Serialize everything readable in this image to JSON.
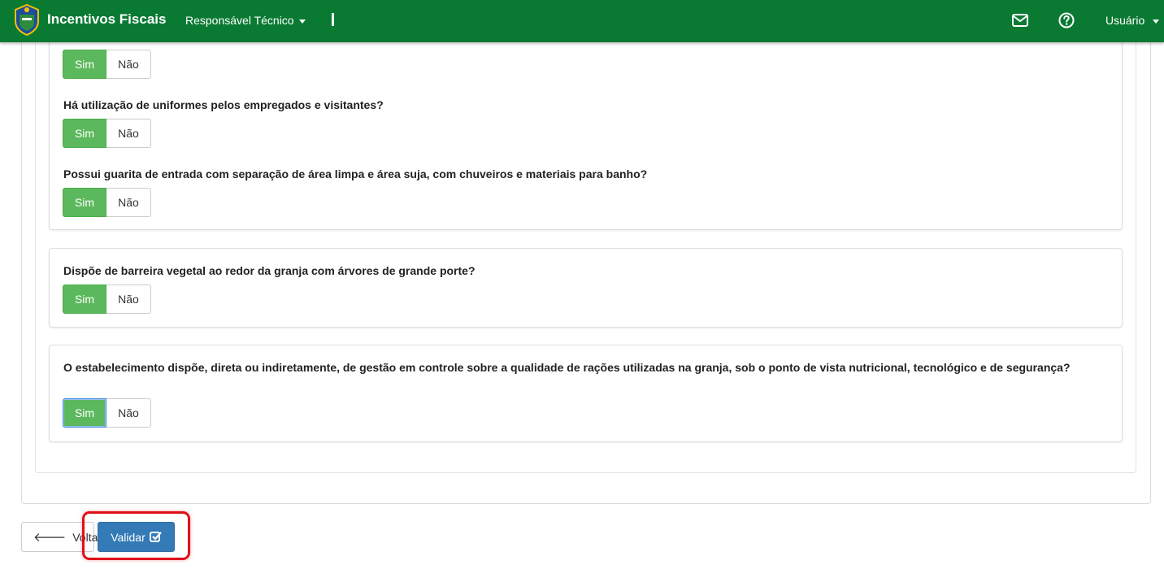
{
  "header": {
    "app_title": "Incentivos Fiscais",
    "menu_label": "Responsável Técnico",
    "user_label": "Usuário",
    "bar_color": "#0a7a33",
    "icons": [
      "mail-icon",
      "help-icon"
    ]
  },
  "questions": [
    {
      "text": "Há utilização de uniformes pelos empregados e visitantes?",
      "yes": "Sim",
      "no": "Não",
      "selected": "Sim"
    },
    {
      "text": "Possui guarita de entrada com separação de área limpa e área suja, com chuveiros e materiais para banho?",
      "yes": "Sim",
      "no": "Não",
      "selected": "Sim"
    },
    {
      "text": "Dispõe de barreira vegetal ao redor da granja com árvores de grande porte?",
      "yes": "Sim",
      "no": "Não",
      "selected": "Sim"
    },
    {
      "text": "O estabelecimento dispõe, direta ou indiretamente, de gestão em controle sobre a qualidade de rações utilizadas na granja, sob o ponto de vista nutricional, tecnológico e de segurança?",
      "yes": "Sim",
      "no": "Não",
      "selected": "Sim"
    }
  ],
  "partial_top": {
    "yes": "Sim",
    "no": "Não",
    "selected": "Sim"
  },
  "footer": {
    "back_label": "Voltar",
    "validate_label": "Validar",
    "accent_color": "#337ab7",
    "highlight_color": "#e0101a"
  }
}
